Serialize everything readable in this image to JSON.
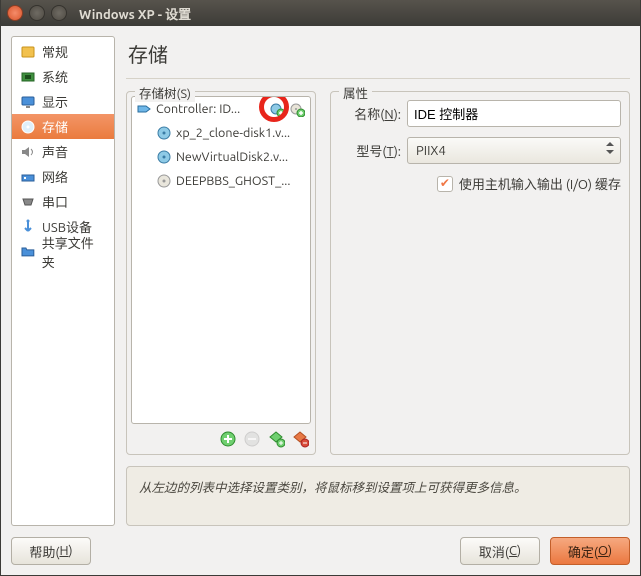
{
  "window": {
    "title": "Windows XP - 设置"
  },
  "sidebar": {
    "items": [
      {
        "label": "常规",
        "name": "sidebar-item-general"
      },
      {
        "label": "系统",
        "name": "sidebar-item-system"
      },
      {
        "label": "显示",
        "name": "sidebar-item-display"
      },
      {
        "label": "存储",
        "name": "sidebar-item-storage",
        "selected": true
      },
      {
        "label": "声音",
        "name": "sidebar-item-audio"
      },
      {
        "label": "网络",
        "name": "sidebar-item-network"
      },
      {
        "label": "串口",
        "name": "sidebar-item-serial"
      },
      {
        "label": "USB设备",
        "name": "sidebar-item-usb"
      },
      {
        "label": "共享文件夹",
        "name": "sidebar-item-shared-folders"
      }
    ]
  },
  "page": {
    "title": "存储",
    "tree_legend": "存储树(S)",
    "attrs_legend": "属性",
    "controller": {
      "label": "Controller: ID...",
      "children": [
        {
          "label": "xp_2_clone-disk1.v...",
          "icon": "disk"
        },
        {
          "label": "NewVirtualDisk2.v...",
          "icon": "disk"
        },
        {
          "label": "DEEPBBS_GHOST_...",
          "icon": "cd"
        }
      ]
    },
    "attrs": {
      "name_label": "名称(N):",
      "name_value": "IDE 控制器",
      "type_label": "型号(T):",
      "type_value": "PIIX4",
      "checkbox_label": "使用主机输入输出 (I/O) 缓存"
    },
    "hint": "从左边的列表中选择设置类别，将鼠标移到设置项上可获得更多信息。"
  },
  "buttons": {
    "help": "帮助(H)",
    "cancel": "取消(C)",
    "ok": "确定(O)"
  }
}
